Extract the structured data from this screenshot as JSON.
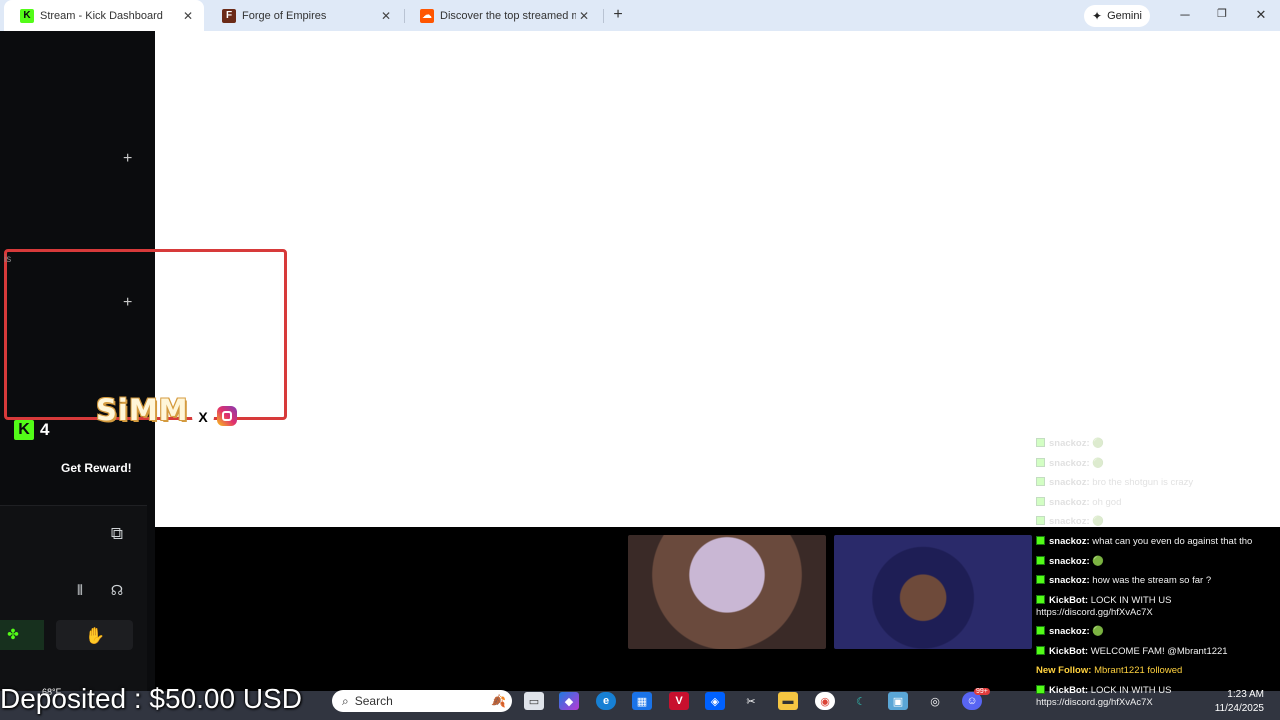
{
  "browser": {
    "tabs": [
      {
        "title": "Stream - Kick Dashboard",
        "active": true,
        "favicon_letter": "K",
        "favicon_color": "#53fc18"
      },
      {
        "title": "Forge of Empires",
        "active": false,
        "favicon_letter": "F",
        "favicon_color": "#6b2a17"
      },
      {
        "title": "Discover the top streamed mus",
        "active": false,
        "favicon_letter": "",
        "favicon_color": "#ff5500"
      }
    ],
    "new_tab_label": "+",
    "gemini_label": "Gemini",
    "window_controls": [
      "─",
      "❐",
      "✕"
    ]
  },
  "dashboard": {
    "panel_fragment_text": "is",
    "overlay_name": "SiMM",
    "viewer_count": "4",
    "reward_button": "Get Reward!",
    "icons": [
      "popout-icon",
      "audio-levels-icon",
      "headphones-icon",
      "grid-icon",
      "hand-raise-icon"
    ]
  },
  "chat": {
    "faded_messages": [
      {
        "user": "snackoz:",
        "text": "🟢"
      },
      {
        "user": "snackoz:",
        "text": "🟢"
      },
      {
        "user": "snackoz:",
        "text": "bro the shotgun is crazy"
      },
      {
        "user": "snackoz:",
        "text": "oh god"
      },
      {
        "user": "snackoz:",
        "text": "🟢"
      }
    ],
    "messages": [
      {
        "user": "snackoz:",
        "text": "what can you even do against that tho"
      },
      {
        "user": "snackoz:",
        "text": "🟢"
      },
      {
        "user": "snackoz:",
        "text": "how was the stream so far ?"
      },
      {
        "user": "KickBot:",
        "text": "LOCK IN WITH US",
        "text2": "https://discord.gg/hfXvAc7X"
      },
      {
        "user": "snackoz:",
        "text": "🟢"
      },
      {
        "user": "KickBot:",
        "text": "WELCOME FAM! @Mbrant1221"
      },
      {
        "user": "New Follow:",
        "text": "Mbrant1221 followed",
        "follow": true
      },
      {
        "user": "KickBot:",
        "text": "LOCK IN WITH US",
        "text2": "https://discord.gg/hfXvAc7X"
      }
    ]
  },
  "banner": {
    "deposited_text": "Deposited : $50.00 USD"
  },
  "taskbar": {
    "weather": "68°F",
    "search_placeholder": "Search",
    "time": "1:23 AM",
    "date": "11/24/2025",
    "discord_badge": "99+"
  },
  "colors": {
    "kick_green": "#53fc18",
    "alert_red": "#d73a3a",
    "follow_yellow": "#ffd23f"
  }
}
